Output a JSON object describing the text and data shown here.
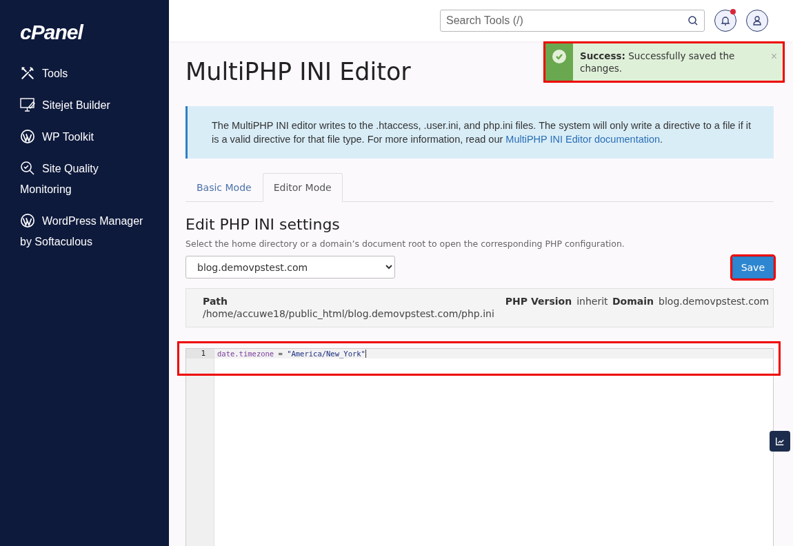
{
  "sidebar": {
    "logo": "cPanel",
    "items": [
      {
        "label": "Tools"
      },
      {
        "label": "Sitejet Builder"
      },
      {
        "label": "WP Toolkit"
      },
      {
        "label": "Site Quality Monitoring"
      },
      {
        "label": "WordPress Manager by Softaculous"
      }
    ]
  },
  "header": {
    "search": {
      "placeholder": "Search Tools (/)"
    },
    "notifications": {
      "unread": true
    }
  },
  "toast": {
    "title": "Success:",
    "message": "Successfully saved the changes.",
    "close": "×",
    "highlighted": true
  },
  "page_title": "MultiPHP INI Editor",
  "info": {
    "text": "The MultiPHP INI editor writes to the .htaccess, .user.ini, and php.ini files. The system will only write a directive to a file if it is a valid directive for that file type. For more information, read our",
    "link": "MultiPHP INI Editor documentation",
    "end": "."
  },
  "tabs": [
    {
      "label": "Basic Mode",
      "selected": false
    },
    {
      "label": "Editor Mode",
      "selected": true
    }
  ],
  "section": {
    "title": "Edit PHP INI settings",
    "hint": "Select the home directory or a domain’s document root to open the corresponding PHP configuration."
  },
  "location_select": {
    "value": "blog.demovpstest.com"
  },
  "save_button": {
    "label": "Save",
    "highlighted": true
  },
  "details": {
    "path_label": "Path",
    "path": "/home/accuwe18/public_html/blog.demovpstest.com/php.ini",
    "version_label": "PHP Version",
    "version": "inherit",
    "domain_label": "Domain",
    "domain": "blog.demovpstest.com"
  },
  "editor": {
    "highlighted": true,
    "lines": [
      {
        "number": "1",
        "key": "date.timezone",
        "operator": "=",
        "value": "\"America/New_York\""
      }
    ]
  }
}
